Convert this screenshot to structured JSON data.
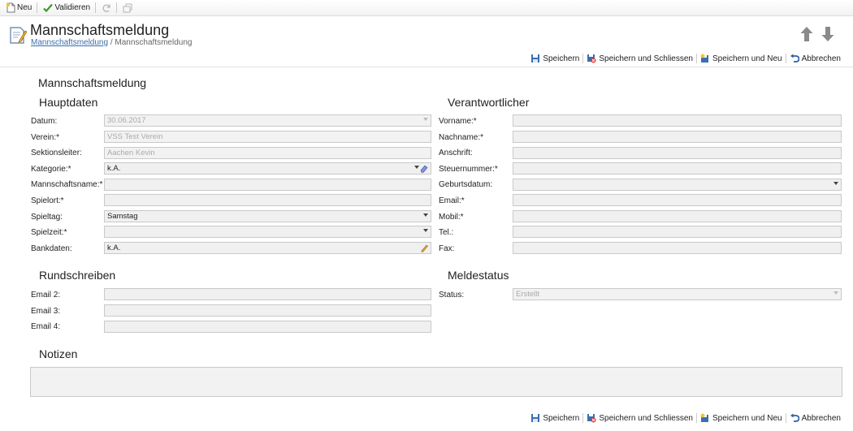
{
  "toolbar": {
    "new_label": "Neu",
    "validate_label": "Validieren"
  },
  "header": {
    "title": "Mannschaftsmeldung",
    "breadcrumb_link": "Mannschaftsmeldung",
    "breadcrumb_sep": " / ",
    "breadcrumb_current": "Mannschaftsmeldung"
  },
  "actions": {
    "save": "Speichern",
    "save_close": "Speichern und Schliessen",
    "save_new": "Speichern und Neu",
    "cancel": "Abbrechen"
  },
  "form": {
    "title": "Mannschaftsmeldung",
    "hauptdaten": {
      "heading": "Hauptdaten",
      "datum_label": "Datum:",
      "datum_value": "30.06.2017",
      "verein_label": "Verein:*",
      "verein_value": "VSS Test Verein",
      "sektionsleiter_label": "Sektionsleiter:",
      "sektionsleiter_value": "Aachen Kevin",
      "kategorie_label": "Kategorie:*",
      "kategorie_value": "k.A.",
      "mannschaftsname_label": "Mannschaftsname:*",
      "mannschaftsname_value": "",
      "spielort_label": "Spielort:*",
      "spielort_value": "",
      "spieltag_label": "Spieltag:",
      "spieltag_value": "Samstag",
      "spielzeit_label": "Spielzeit:*",
      "spielzeit_value": "",
      "bankdaten_label": "Bankdaten:",
      "bankdaten_value": "k.A."
    },
    "verantwortlicher": {
      "heading": "Verantwortlicher",
      "vorname_label": "Vorname:*",
      "nachname_label": "Nachname:*",
      "anschrift_label": "Anschrift:",
      "steuernummer_label": "Steuernummer:*",
      "geburtsdatum_label": "Geburtsdatum:",
      "email_label": "Email:*",
      "mobil_label": "Mobil:*",
      "tel_label": "Tel.:",
      "fax_label": "Fax:"
    },
    "rundschreiben": {
      "heading": "Rundschreiben",
      "email2_label": "Email 2:",
      "email3_label": "Email 3:",
      "email4_label": "Email 4:"
    },
    "meldestatus": {
      "heading": "Meldestatus",
      "status_label": "Status:",
      "status_value": "Erstellt"
    },
    "notizen": {
      "heading": "Notizen"
    }
  }
}
